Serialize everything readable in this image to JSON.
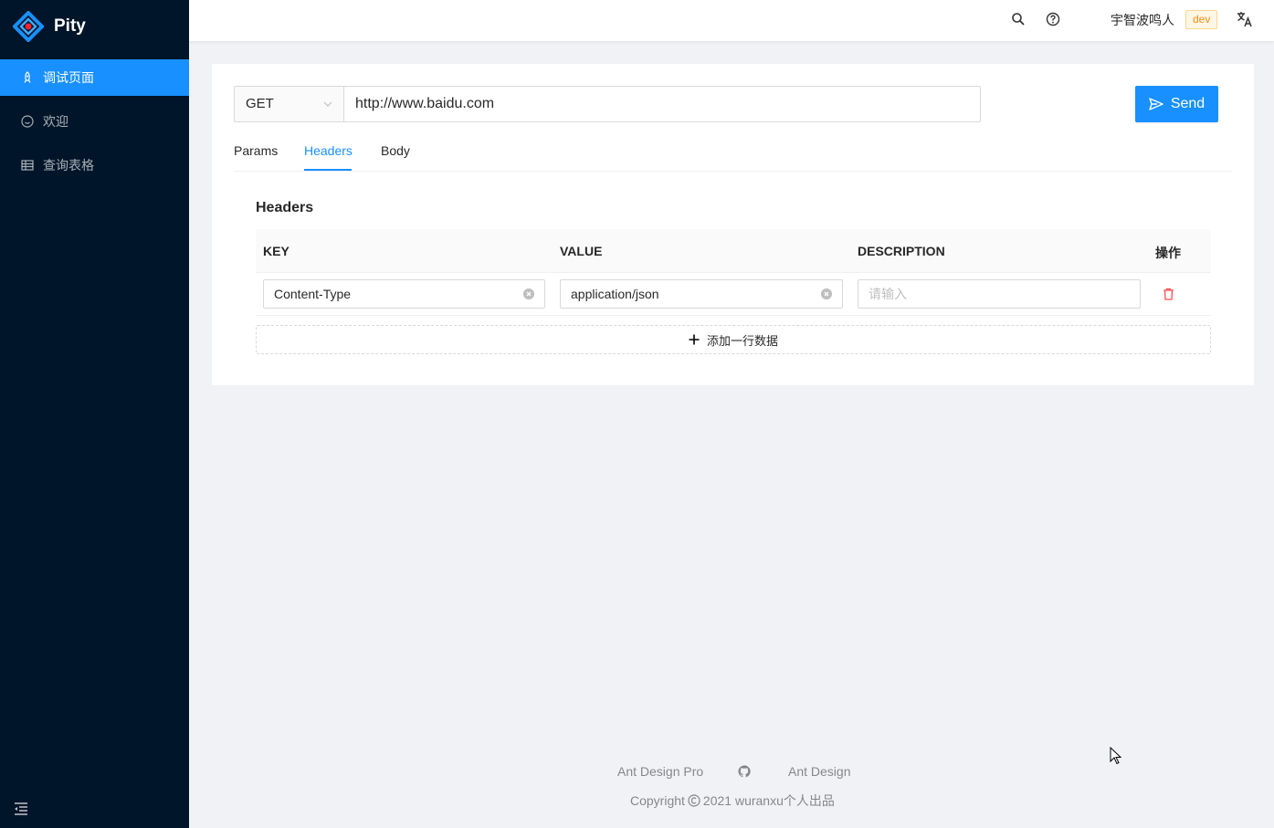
{
  "app": {
    "title": "Pity",
    "logo_icon": "diamond-logo-icon"
  },
  "sidebar": {
    "items": [
      {
        "label": "调试页面",
        "icon": "rocket-icon",
        "active": true
      },
      {
        "label": "欢迎",
        "icon": "smile-icon",
        "active": false
      },
      {
        "label": "查询表格",
        "icon": "table-icon",
        "active": false
      }
    ],
    "collapse_icon": "menu-fold-icon"
  },
  "header": {
    "search_icon": "search-icon",
    "help_icon": "question-circle-icon",
    "user_name": "宇智波鸣人",
    "env_tag": "dev",
    "lang_icon": "translate-icon"
  },
  "request": {
    "method": "GET",
    "url": "http://www.baidu.com",
    "send_label": "Send"
  },
  "tabs": [
    {
      "label": "Params",
      "active": false
    },
    {
      "label": "Headers",
      "active": true
    },
    {
      "label": "Body",
      "active": false
    }
  ],
  "headers_section": {
    "title": "Headers",
    "columns": [
      "KEY",
      "VALUE",
      "DESCRIPTION",
      "操作"
    ],
    "rows": [
      {
        "key": "Content-Type",
        "value": "application/json",
        "description": "",
        "description_placeholder": "请输入"
      }
    ],
    "add_row_label": "添加一行数据"
  },
  "footer": {
    "links": [
      "Ant Design Pro",
      "Ant Design"
    ],
    "github_icon": "github-icon",
    "copyright_prefix": "Copyright",
    "copyright_text": "2021 wuranxu个人出品"
  },
  "colors": {
    "primary": "#1890ff",
    "sider": "#001529",
    "danger": "#ff4d4f",
    "tag": "#fa8c16"
  }
}
